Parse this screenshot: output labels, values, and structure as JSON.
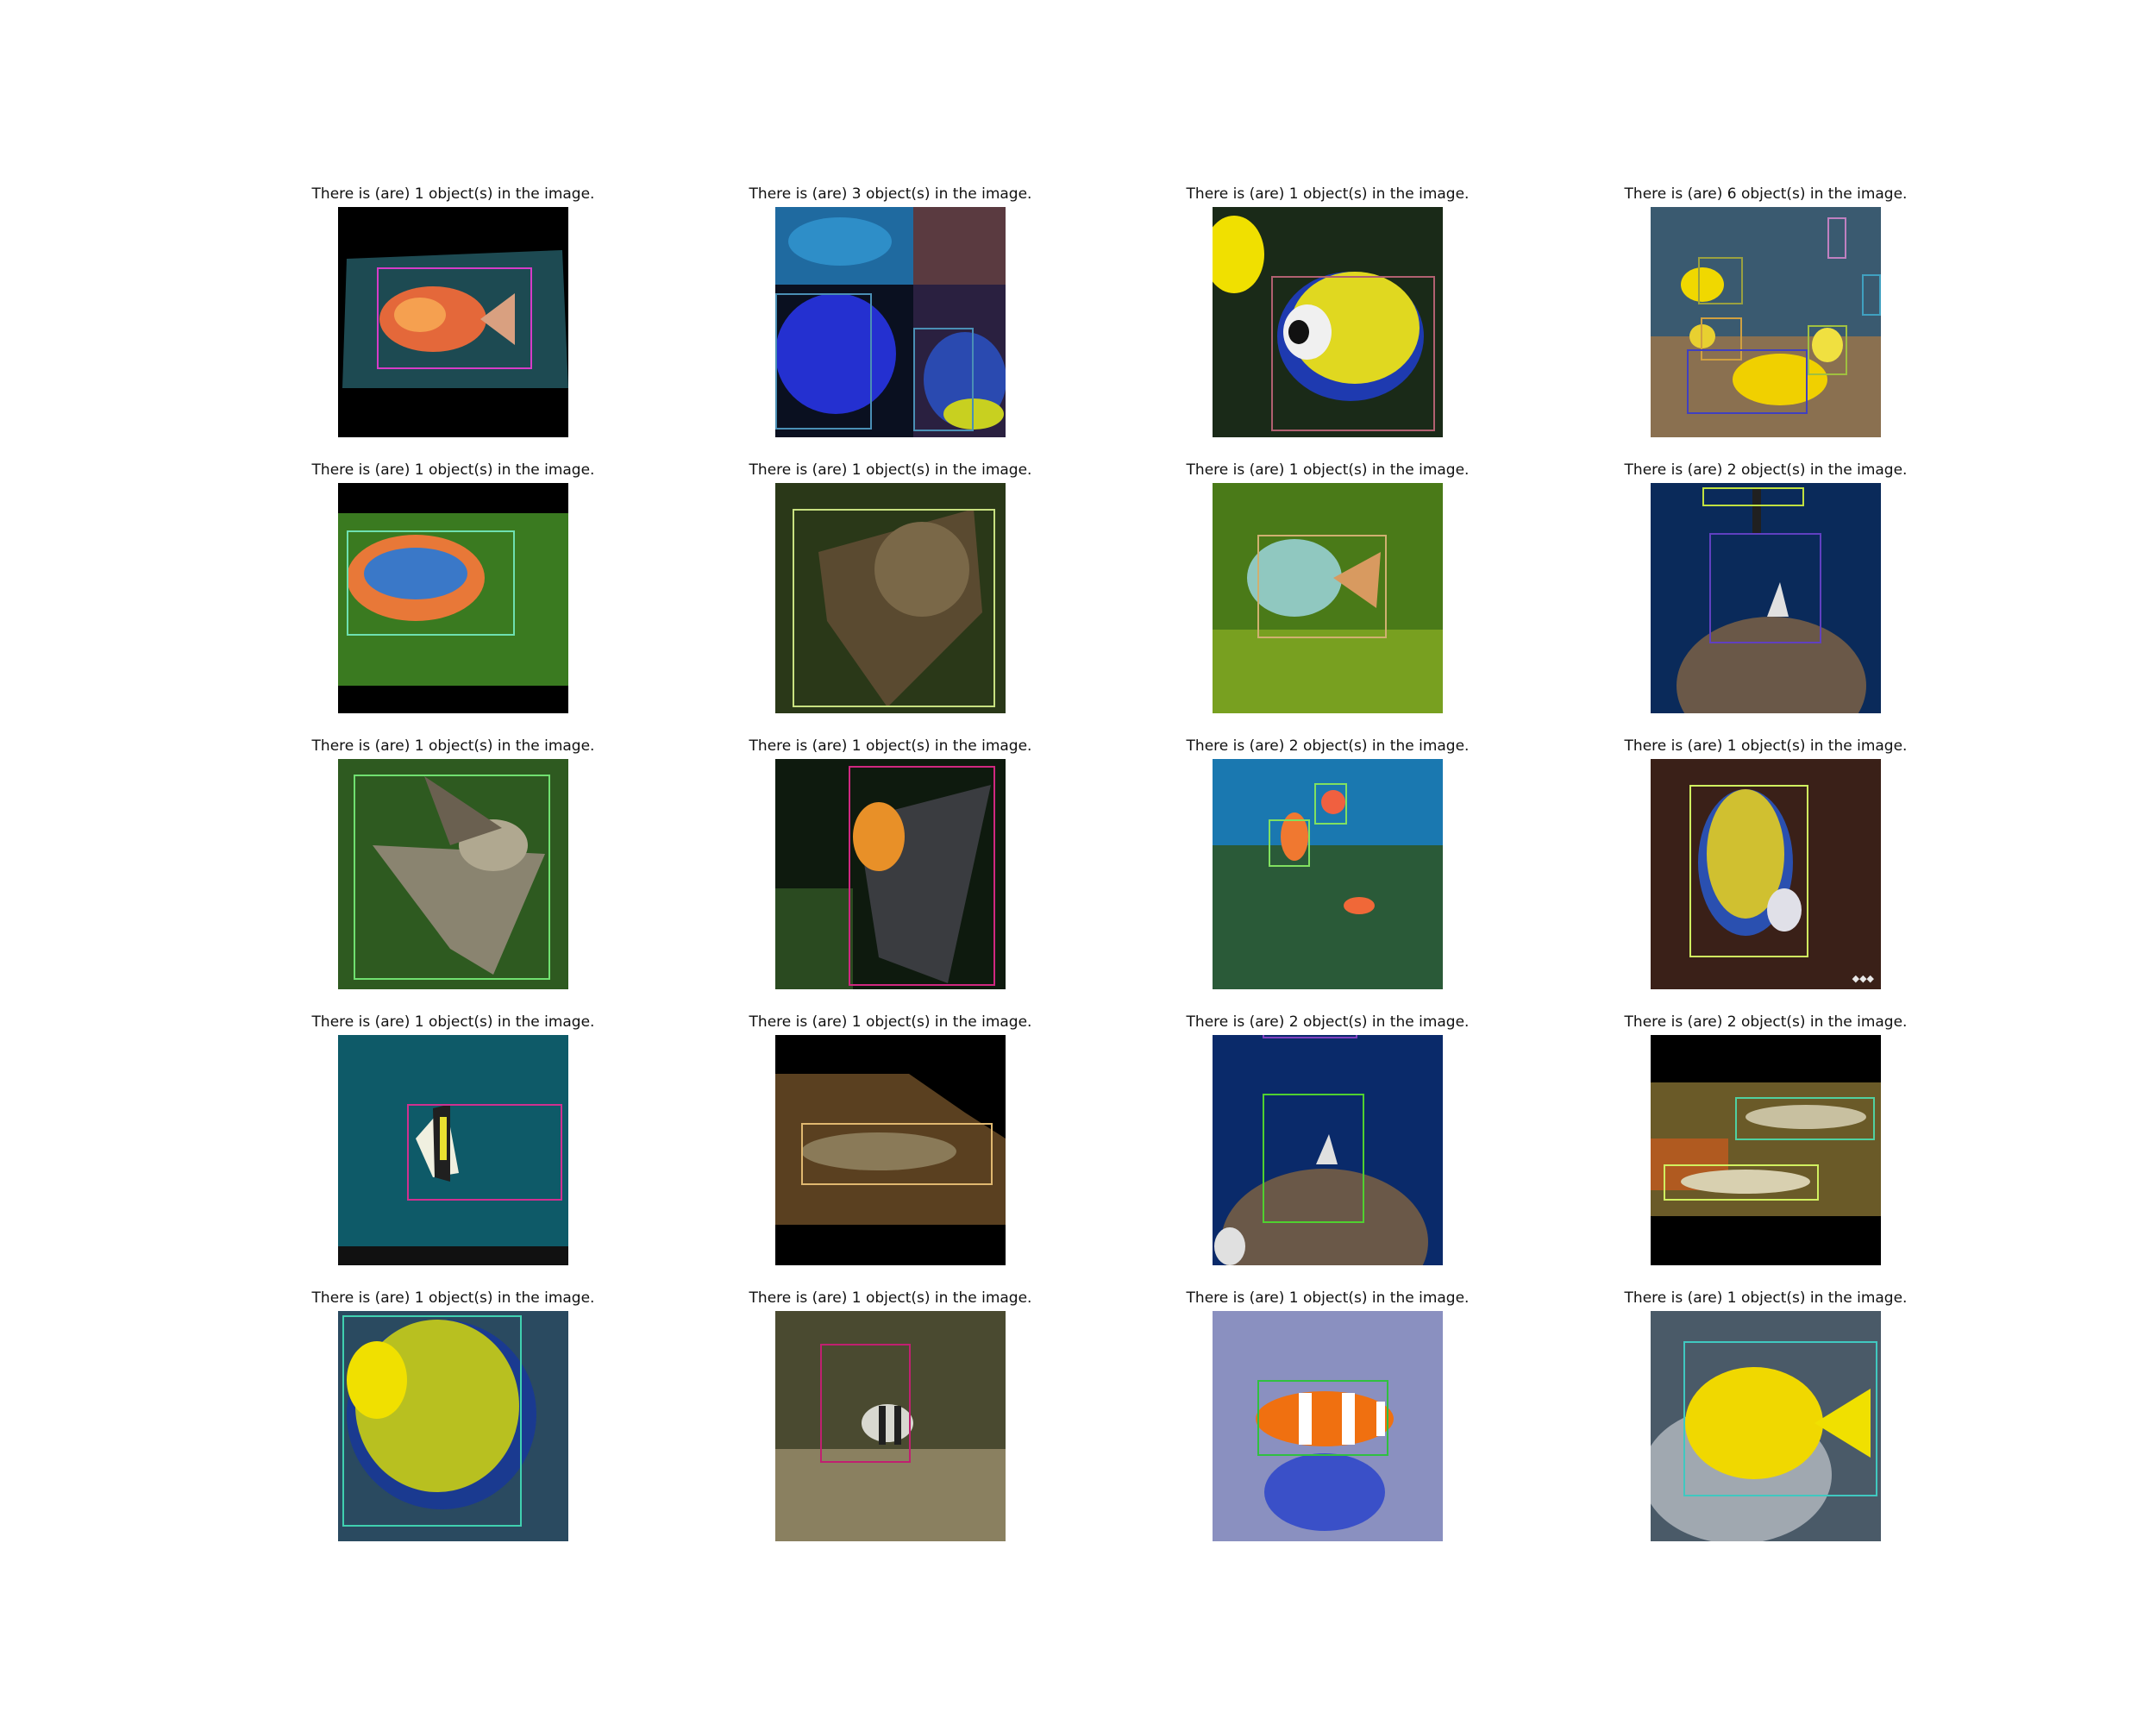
{
  "panels": [
    {
      "title": "There is (are) 1 object(s) in the image.",
      "colors": {
        "box": "#d63cc8"
      }
    },
    {
      "title": "There is (are) 3 object(s) in the image.",
      "colors": {
        "box": "#4a8fb5"
      }
    },
    {
      "title": "There is (are) 1 object(s) in the image.",
      "colors": {
        "box": "#b06070"
      }
    },
    {
      "title": "There is (are) 6 object(s) in the image.",
      "colors": {
        "box": "#9aa040"
      }
    },
    {
      "title": "There is (are) 1 object(s) in the image.",
      "colors": {
        "box": "#6ee0b0"
      }
    },
    {
      "title": "There is (are) 1 object(s) in the image.",
      "colors": {
        "box": "#c8e080"
      }
    },
    {
      "title": "There is (are) 1 object(s) in the image.",
      "colors": {
        "box": "#d0b070"
      }
    },
    {
      "title": "There is (are) 2 object(s) in the image.",
      "colors": {
        "box": "#6040c0"
      }
    },
    {
      "title": "There is (are) 1 object(s) in the image.",
      "colors": {
        "box": "#70e070"
      }
    },
    {
      "title": "There is (are) 1 object(s) in the image.",
      "colors": {
        "box": "#d02880"
      }
    },
    {
      "title": "There is (are) 2 object(s) in the image.",
      "colors": {
        "box": "#80e060"
      }
    },
    {
      "title": "There is (are) 1 object(s) in the image.",
      "colors": {
        "box": "#d0f060"
      }
    },
    {
      "title": "There is (are) 1 object(s) in the image.",
      "colors": {
        "box": "#d03090"
      }
    },
    {
      "title": "There is (are) 1 object(s) in the image.",
      "colors": {
        "box": "#e0b870"
      }
    },
    {
      "title": "There is (are) 2 object(s) in the image.",
      "colors": {
        "box": "#50d030"
      }
    },
    {
      "title": "There is (are) 2 object(s) in the image.",
      "colors": {
        "box": "#50d0a0"
      }
    },
    {
      "title": "There is (are) 1 object(s) in the image.",
      "colors": {
        "box": "#40d0b0"
      }
    },
    {
      "title": "There is (are) 1 object(s) in the image.",
      "colors": {
        "box": "#c02070"
      }
    },
    {
      "title": "There is (are) 1 object(s) in the image.",
      "colors": {
        "box": "#30c040"
      }
    },
    {
      "title": "There is (are) 1 object(s) in the image.",
      "colors": {
        "box": "#40c8c0"
      }
    }
  ]
}
